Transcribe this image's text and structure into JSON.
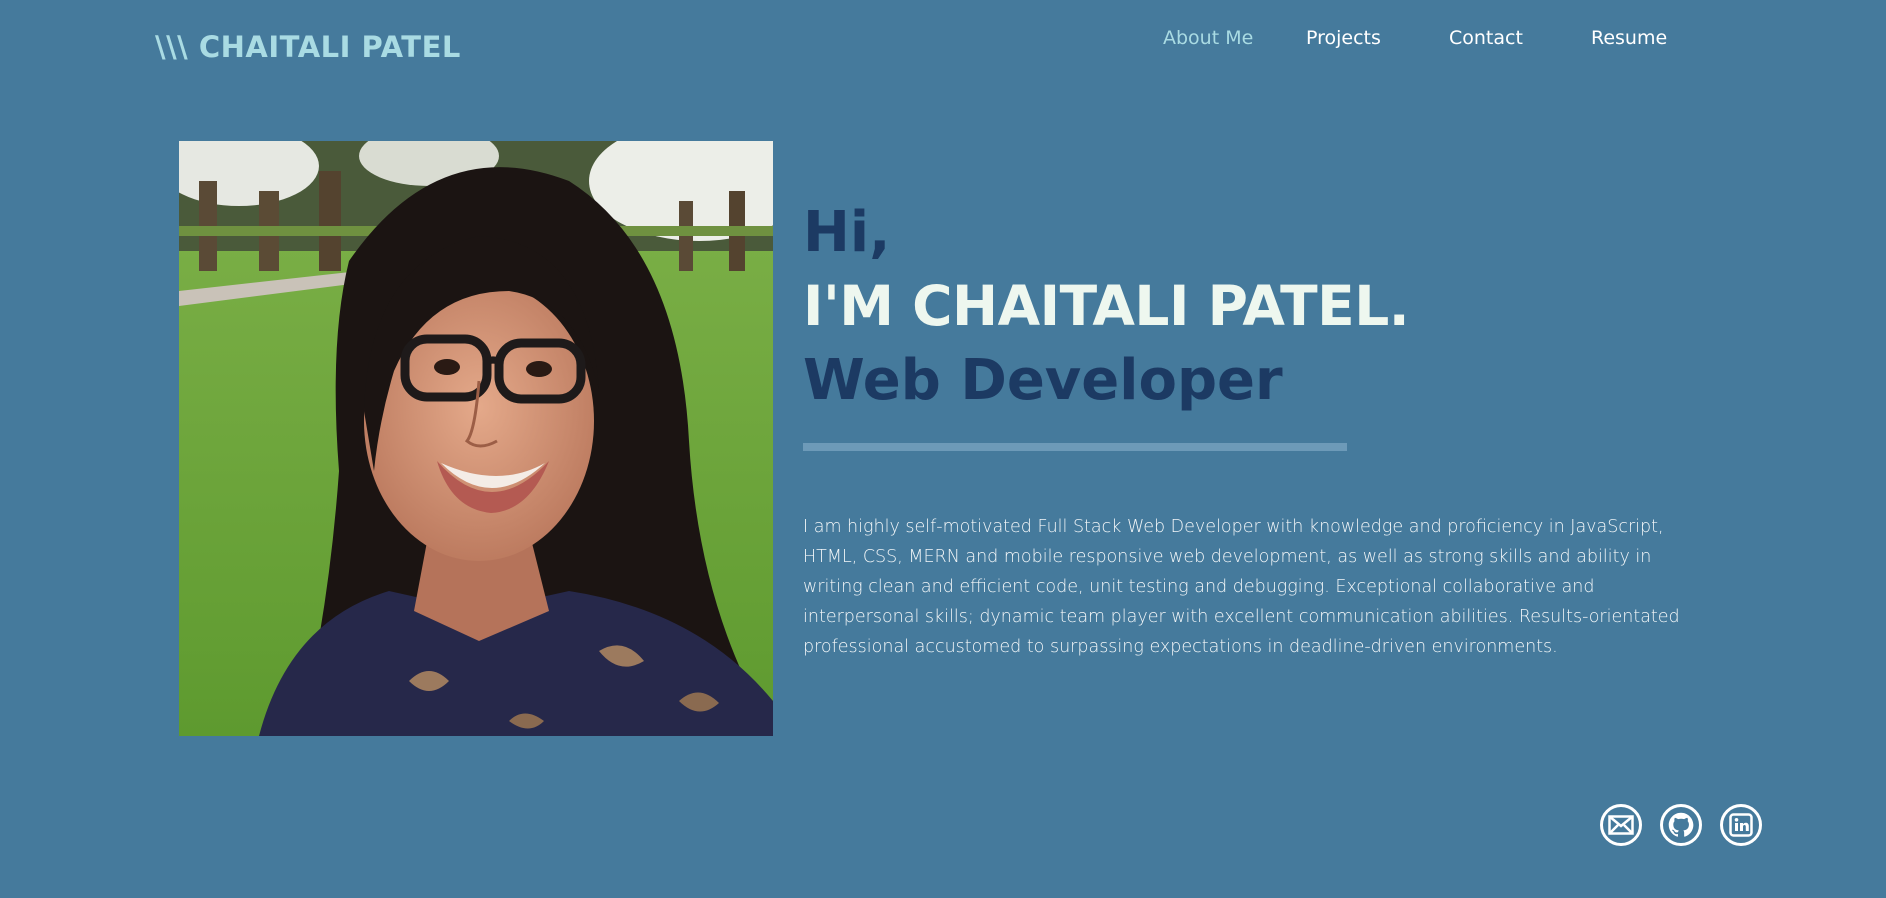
{
  "header": {
    "logo_text": "\\\\\\ CHAITALI PATEL",
    "nav": [
      {
        "label": "About Me",
        "active": true
      },
      {
        "label": "Projects",
        "active": false
      },
      {
        "label": "Contact",
        "active": false
      },
      {
        "label": "Resume",
        "active": false
      }
    ]
  },
  "hero": {
    "greeting": "Hi,",
    "name": "I'M CHAITALI PATEL.",
    "role": "Web Developer",
    "bio": "I am highly self-motivated Full Stack Web Developer with knowledge and proficiency in JavaScript, HTML, CSS, MERN and mobile responsive web development, as well as strong skills and ability in writing clean and efficient code, unit testing and debugging. Exceptional collaborative and interpersonal skills; dynamic team player with excellent communication abilities. Results-orientated professional accustomed to surpassing expectations in deadline-driven environments."
  },
  "social": [
    {
      "icon": "mail-icon"
    },
    {
      "icon": "github-icon"
    },
    {
      "icon": "linkedin-icon"
    }
  ],
  "colors": {
    "background": "#457a9c",
    "accent_light": "#a9dbe3",
    "heading_dark": "#1c3a63",
    "heading_light": "#eef7ef",
    "divider": "#6d9ab8"
  }
}
